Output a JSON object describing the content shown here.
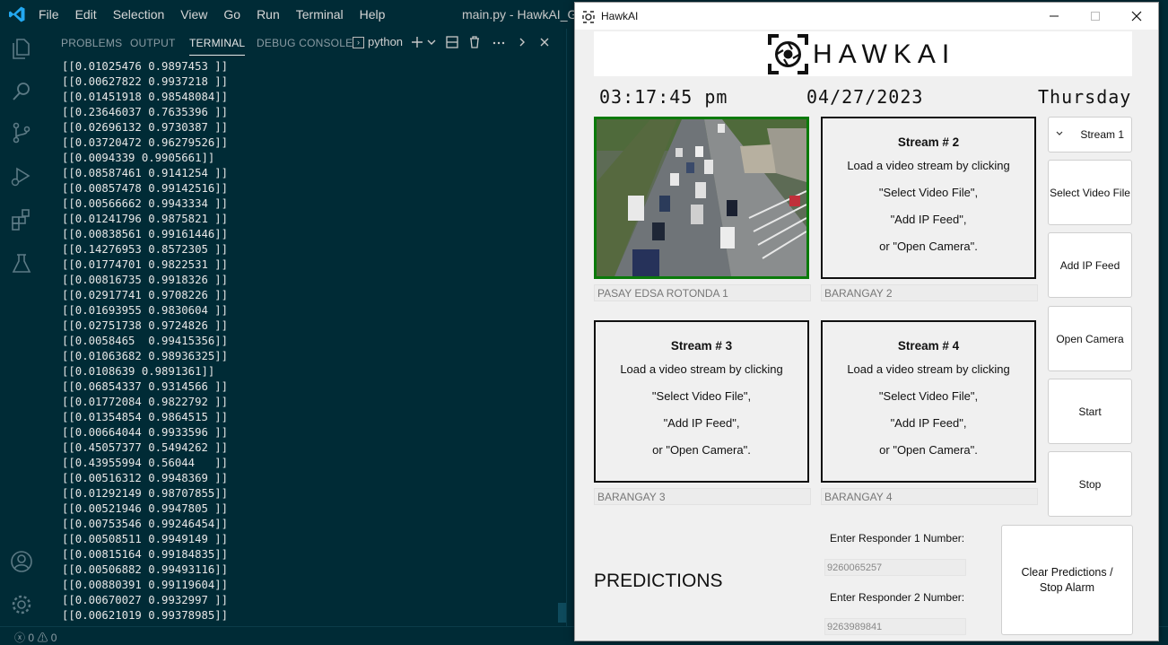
{
  "vscode": {
    "menu": [
      "File",
      "Edit",
      "Selection",
      "View",
      "Go",
      "Run",
      "Terminal",
      "Help"
    ],
    "window_title": "main.py - HawkAI_GUI-",
    "panel_tabs": [
      "PROBLEMS",
      "OUTPUT",
      "TERMINAL",
      "DEBUG CONSOLE"
    ],
    "active_tab": "TERMINAL",
    "terminal_name": "python",
    "terminal_lines": [
      "[[0.01025476 0.9897453 ]]",
      "[[0.00627822 0.9937218 ]]",
      "[[0.01451918 0.98548084]]",
      "[[0.23646037 0.7635396 ]]",
      "[[0.02696132 0.9730387 ]]",
      "[[0.03720472 0.96279526]]",
      "[[0.0094339 0.9905661]]",
      "[[0.08587461 0.9141254 ]]",
      "[[0.00857478 0.99142516]]",
      "[[0.00566662 0.9943334 ]]",
      "[[0.01241796 0.9875821 ]]",
      "[[0.00838561 0.99161446]]",
      "[[0.14276953 0.8572305 ]]",
      "[[0.01774701 0.9822531 ]]",
      "[[0.00816735 0.9918326 ]]",
      "[[0.02917741 0.9708226 ]]",
      "[[0.01693955 0.9830604 ]]",
      "[[0.02751738 0.9724826 ]]",
      "[[0.0058465  0.99415356]]",
      "[[0.01063682 0.98936325]]",
      "[[0.0108639 0.9891361]]",
      "[[0.06854337 0.9314566 ]]",
      "[[0.01772084 0.9822792 ]]",
      "[[0.01354854 0.9864515 ]]",
      "[[0.00664044 0.9933596 ]]",
      "[[0.45057377 0.5494262 ]]",
      "[[0.43955994 0.56044   ]]",
      "[[0.00516312 0.9948369 ]]",
      "[[0.01292149 0.98707855]]",
      "[[0.00521946 0.9947805 ]]",
      "[[0.00753546 0.99246454]]",
      "[[0.00508511 0.9949149 ]]",
      "[[0.00815164 0.99184835]]",
      "[[0.00506882 0.99493116]]",
      "[[0.00880391 0.99119604]]",
      "[[0.00670027 0.9932997 ]]",
      "[[0.00621019 0.99378985]]"
    ],
    "status": {
      "errors": "0",
      "warnings": "0"
    }
  },
  "hawkai": {
    "window_title": "HawkAI",
    "logo_text": "HAWKAI",
    "time": "03:17:45 pm",
    "date": "04/27/2023",
    "day": "Thursday",
    "stream_select": "Stream 1",
    "streams": [
      {
        "label": "PASAY EDSA ROTONDA 1",
        "active": true
      },
      {
        "title": "Stream # 2",
        "lines": [
          "Load a video stream by clicking",
          "\"Select Video File\",",
          "\"Add IP Feed\",",
          "or \"Open Camera\"."
        ],
        "label": "BARANGAY 2"
      },
      {
        "title": "Stream # 3",
        "lines": [
          "Load a video stream by clicking",
          "\"Select Video File\",",
          "\"Add IP Feed\",",
          "or \"Open Camera\"."
        ],
        "label": "BARANGAY 3"
      },
      {
        "title": "Stream # 4",
        "lines": [
          "Load a video stream by clicking",
          "\"Select Video File\",",
          "\"Add IP Feed\",",
          "or \"Open Camera\"."
        ],
        "label": "BARANGAY 4"
      }
    ],
    "buttons": {
      "select_video": "Select Video File",
      "add_ip": "Add IP Feed",
      "open_camera": "Open Camera",
      "start": "Start",
      "stop": "Stop",
      "clear_line1": "Clear Predictions /",
      "clear_line2": "Stop Alarm"
    },
    "predictions_title": "PREDICTIONS",
    "responder1_label": "Enter Responder 1 Number:",
    "responder1_value": "9260065257",
    "responder2_label": "Enter Responder 2 Number:",
    "responder2_value": "9263989841"
  },
  "colors": {
    "vscode_bg": "#002b36",
    "active_stream_border": "#0a7a0a",
    "vscode_accent": "#23a9f2"
  }
}
